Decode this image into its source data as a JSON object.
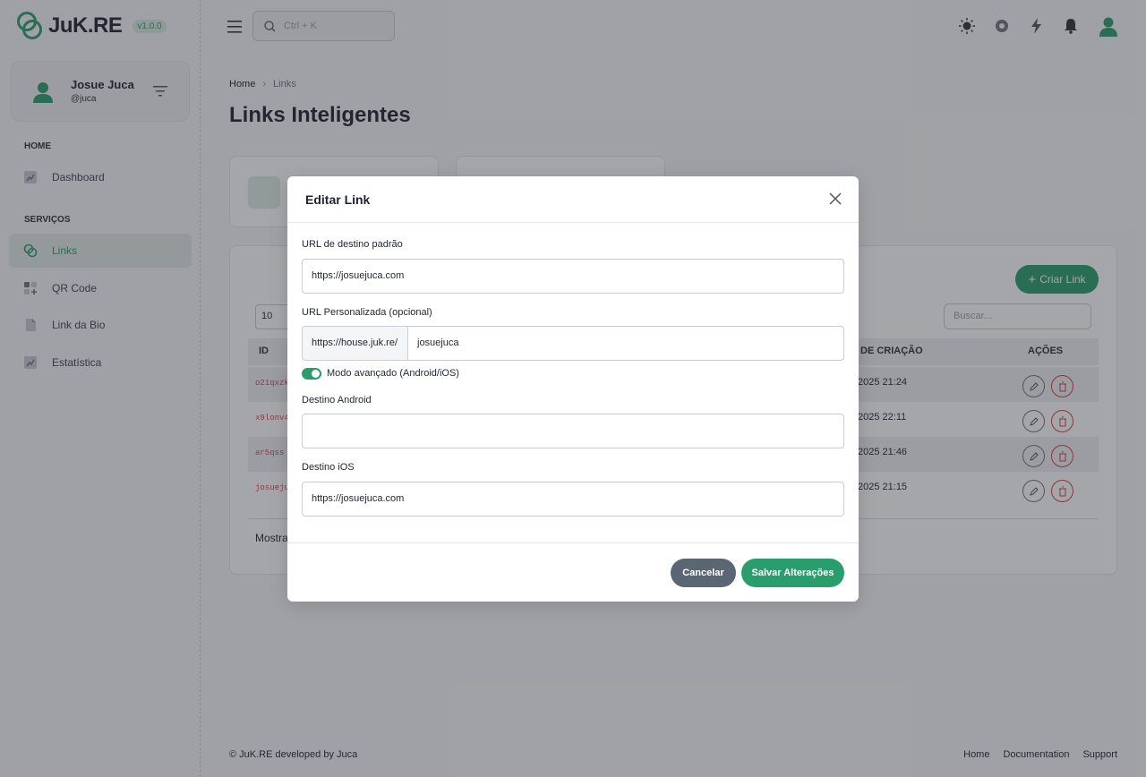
{
  "app": {
    "brand": "JuK.RE",
    "version": "v1.0.0"
  },
  "user": {
    "name": "Josue Juca",
    "handle": "@juca"
  },
  "sidebar": {
    "sections": [
      "HOME",
      "SERVIÇOS"
    ],
    "items": [
      {
        "label": "Dashboard"
      },
      {
        "label": "Links"
      },
      {
        "label": "QR Code"
      },
      {
        "label": "Link da Bio"
      },
      {
        "label": "Estatística"
      }
    ]
  },
  "header": {
    "search_placeholder": "Ctrl + K"
  },
  "breadcrumb": {
    "home": "Home",
    "current": "Links"
  },
  "page": {
    "title": "Links Inteligentes"
  },
  "table": {
    "create_label": "Criar Link",
    "page_size": "10",
    "search_placeholder": "Buscar...",
    "headers": {
      "id": "ID",
      "created": "DE CRIAÇÃO",
      "actions": "AÇÕES"
    },
    "rows": [
      {
        "id": "o21qxzk",
        "date": "2025 21:24"
      },
      {
        "id": "x9lonv4",
        "date": "2025 22:11"
      },
      {
        "id": "ar5qss",
        "date": "2025 21:46"
      },
      {
        "id": "josueju",
        "date": "2025 21:15"
      }
    ],
    "showing": "Mostrar"
  },
  "modal": {
    "title": "Editar Link",
    "default_url_label": "URL de destino padrão",
    "default_url_value": "https://josuejuca.com",
    "custom_url_label": "URL Personalizada (opcional)",
    "custom_prefix": "https://house.juk.re/",
    "custom_slug": "josuejuca",
    "advanced_label": "Modo avançado (Android/iOS)",
    "android_label": "Destino Android",
    "android_value": "",
    "ios_label": "Destino iOS",
    "ios_value": "https://josuejuca.com",
    "cancel": "Cancelar",
    "save": "Salvar Alterações"
  },
  "footer": {
    "copyright": "© JuK.RE developed by Juca",
    "links": [
      "Home",
      "Documentation",
      "Support"
    ]
  },
  "colors": {
    "accent": "#2a9d6c",
    "danger": "#d04040",
    "secondary": "#5a6674"
  }
}
